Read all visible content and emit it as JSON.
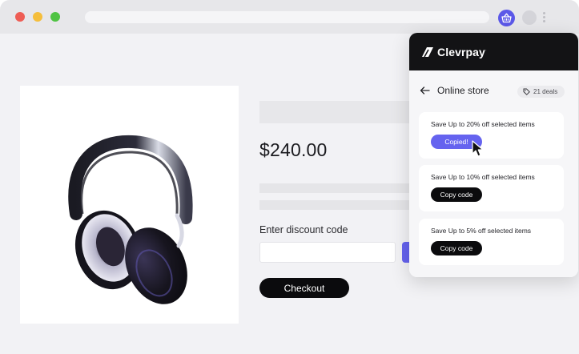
{
  "browser": {
    "window_controls": [
      "close",
      "minimize",
      "maximize"
    ],
    "extension_icon": "basket-icon",
    "accent_color": "#5b58e8"
  },
  "product": {
    "price": "$240.00",
    "discount_label": "Enter discount code",
    "checkout_label": "Checkout"
  },
  "popup": {
    "brand": "Clevrpay",
    "brand_mark": "·",
    "store_title": "Online store",
    "deals_count": "21 deals",
    "deals": [
      {
        "text": "Save Up to 20% off selected items",
        "button": "Copied!",
        "state": "copied"
      },
      {
        "text": "Save Up to 10% off selected items",
        "button": "Copy code",
        "state": "default"
      },
      {
        "text": "Save Up to 5% off selected items",
        "button": "Copy code",
        "state": "default"
      }
    ]
  },
  "colors": {
    "accent": "#6563ef",
    "dark": "#0b0b0d"
  }
}
